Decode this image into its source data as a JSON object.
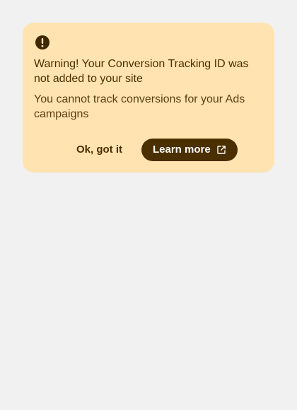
{
  "banner": {
    "icon": "error-circle-icon",
    "title": "Warning! Your Conversion Tracking ID was not added to your site",
    "body": "You cannot track conversions for your Ads campaigns",
    "dismiss_label": "Ok, got it",
    "learn_more_label": "Learn more",
    "learn_more_icon": "external-link-icon"
  },
  "colors": {
    "page_background": "#f1f1f1",
    "banner_background": "#ffe3b0",
    "banner_text": "#4a2f00",
    "button_background": "#4a2f00",
    "button_text": "#ffffff"
  }
}
